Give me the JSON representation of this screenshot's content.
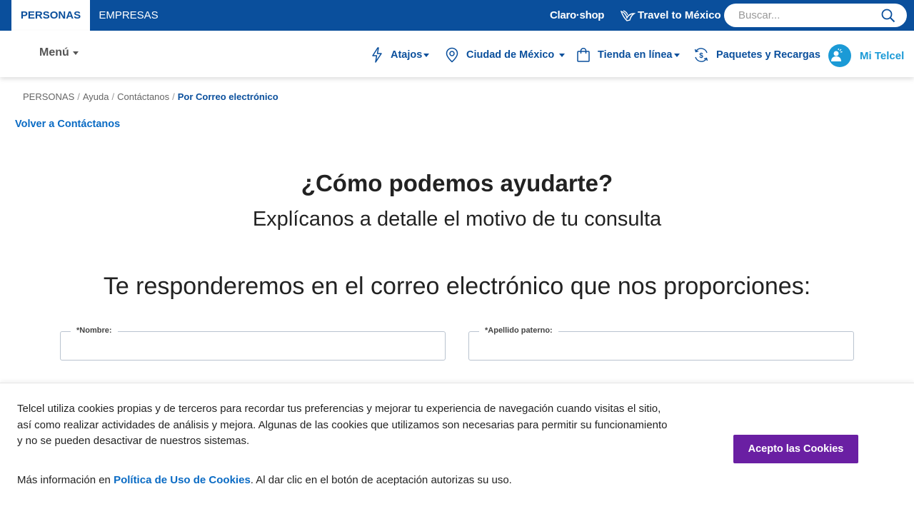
{
  "topbar": {
    "tabs": [
      {
        "label": "PERSONAS",
        "active": true
      },
      {
        "label": "EMPRESAS",
        "active": false
      }
    ],
    "claro_shop_label": "Claro·shop",
    "travel_label": "Travel to México",
    "search": {
      "placeholder": "Buscar...",
      "value": ""
    }
  },
  "mainnav": {
    "menu_label": "Menú",
    "items": [
      {
        "label": "Atajos",
        "icon": "lightning-icon",
        "dropdown": true
      },
      {
        "label": "Ciudad de México",
        "icon": "location-pin-icon",
        "dropdown": true
      },
      {
        "label": "Tienda en línea",
        "icon": "shopping-bag-icon",
        "dropdown": true
      },
      {
        "label": "Paquetes y Recargas",
        "icon": "dollar-refresh-icon",
        "dropdown": false
      },
      {
        "label": "Mi Telcel",
        "icon": "user-avatar-icon",
        "dropdown": false
      }
    ]
  },
  "breadcrumb": {
    "items": [
      "PERSONAS",
      "Ayuda",
      "Contáctanos"
    ],
    "current": "Por Correo electrónico"
  },
  "back_link": "Volver a Contáctanos",
  "content": {
    "heading": "¿Cómo podemos ayudarte?",
    "subheading": "Explícanos a detalle el motivo de tu consulta",
    "respond_text": "Te responderemos en el correo electrónico que nos proporciones:"
  },
  "form": {
    "fields": [
      {
        "label": "*Nombre:",
        "value": ""
      },
      {
        "label": "*Apellido paterno:",
        "value": ""
      }
    ]
  },
  "cookie_banner": {
    "text": "Telcel utiliza cookies propias y de terceros para recordar tus preferencias y mejorar tu experiencia de navegación cuando visitas el sitio, así como realizar actividades de análisis y mejora. Algunas de las cookies que utilizamos son necesarias para permitir su funcionamiento y no se pueden desactivar de nuestros sistemas.",
    "more_prefix": "Más información en ",
    "policy_link": "Política de Uso de Cookies",
    "more_suffix": ". Al dar clic en el botón de aceptación autorizas su uso.",
    "accept_label": "Acepto las Cookies"
  },
  "colors": {
    "brand_blue": "#0a4f9c",
    "link_blue": "#0a6bc4",
    "mitelcel_blue": "#1b9ad6",
    "accept_purple": "#6a1fa3"
  }
}
